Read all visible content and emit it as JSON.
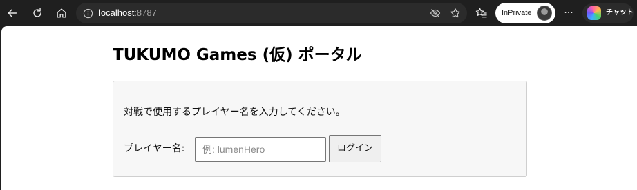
{
  "browser": {
    "address": {
      "host": "localhost",
      "port": ":8787"
    },
    "inprivate_label": "InPrivate",
    "copilot_label": "チャット",
    "more_label": "···",
    "icons": {
      "back": "back-arrow-icon",
      "refresh": "refresh-icon",
      "home": "home-icon",
      "site_info": "info-icon",
      "tracking": "eye-slash-icon",
      "favorite": "star-icon",
      "favorites_list": "favorites-icon",
      "profile": "avatar-icon",
      "copilot": "copilot-icon"
    }
  },
  "page": {
    "title": "TUKUMO Games (仮) ポータル",
    "instruction": "対戦で使用するプレイヤー名を入力してください。",
    "player_label": "プレイヤー名:",
    "player_input": {
      "value": "",
      "placeholder": "例: lumenHero"
    },
    "login_button": "ログイン"
  }
}
